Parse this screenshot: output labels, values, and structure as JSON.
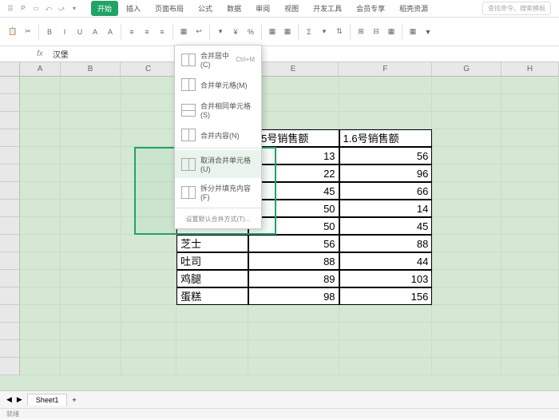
{
  "qat": [
    "☰",
    "P",
    "▭",
    "⤺",
    "⤻",
    "▾"
  ],
  "tabs": [
    "开始",
    "插入",
    "页面布局",
    "公式",
    "数据",
    "审阅",
    "视图",
    "开发工具",
    "会员专享",
    "稻壳资源"
  ],
  "activeTab": 0,
  "searchPlaceholder": "查找命令、搜索模板",
  "nameBox": "",
  "fxValue": "汉堡",
  "colHeaders": [
    "A",
    "B",
    "C",
    "D",
    "E",
    "F",
    "G",
    "H"
  ],
  "menu": {
    "items": [
      {
        "label": "合并居中(C)",
        "shortcut": "Ctrl+M"
      },
      {
        "label": "合并单元格(M)",
        "shortcut": ""
      },
      {
        "label": "合并相同单元格(S)",
        "shortcut": ""
      },
      {
        "label": "合并内容(N)",
        "shortcut": ""
      },
      {
        "label": "取消合并单元格(U)",
        "shortcut": ""
      },
      {
        "label": "拆分并填充内容(F)",
        "shortcut": ""
      }
    ],
    "footer": "设置默认合并方式(T)..."
  },
  "table": {
    "headerE": "1.5号销售额",
    "headerF": "1.6号销售额",
    "rows": [
      {
        "d": "",
        "e": "13",
        "f": "56"
      },
      {
        "d": "",
        "e": "22",
        "f": "96"
      },
      {
        "d": "",
        "e": "45",
        "f": "66"
      },
      {
        "d": "汉堡",
        "e": "50",
        "f": "14"
      },
      {
        "d": "",
        "e": "50",
        "f": "45"
      },
      {
        "d": "芝士",
        "e": "56",
        "f": "88"
      },
      {
        "d": "吐司",
        "e": "88",
        "f": "44"
      },
      {
        "d": "鸡腿",
        "e": "89",
        "f": "103"
      },
      {
        "d": "蛋糕",
        "e": "98",
        "f": "156"
      }
    ]
  },
  "sheetTab": "Sheet1",
  "statusText": "就绪"
}
